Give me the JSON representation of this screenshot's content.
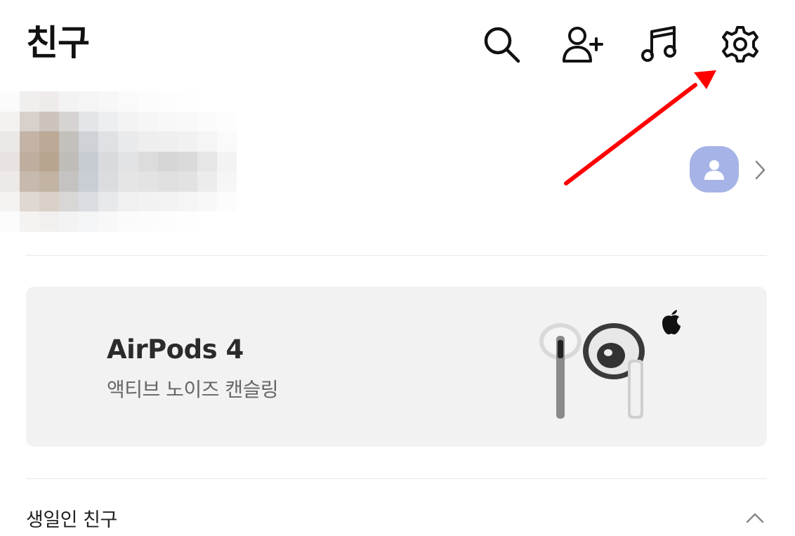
{
  "header": {
    "title": "친구",
    "icons": [
      "search-icon",
      "add-friend-icon",
      "music-icon",
      "settings-icon"
    ]
  },
  "profile": {
    "name": "",
    "avatar_color": "#a6b3e6"
  },
  "ad": {
    "title": "AirPods 4",
    "subtitle": "액티브 노이즈 캔슬링",
    "background": "#f2f2f2"
  },
  "birthday_section": {
    "title": "생일인 친구",
    "expanded": true
  },
  "annotation": {
    "color": "#ff0000",
    "target": "settings-icon"
  }
}
